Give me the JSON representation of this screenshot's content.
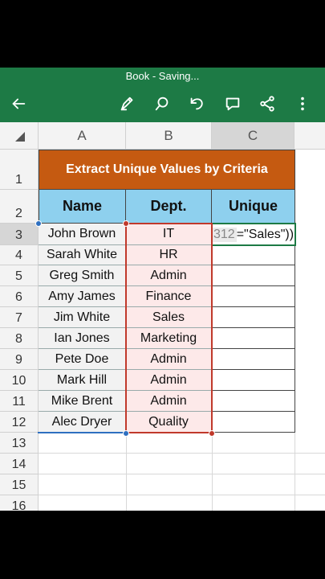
{
  "titlebar": {
    "title": "Book - Saving..."
  },
  "icons": {
    "back": "back-arrow-icon",
    "draw": "pen-icon",
    "search": "search-icon",
    "undo": "undo-icon",
    "comment": "comment-icon",
    "share": "share-icon",
    "more": "more-vertical-icon"
  },
  "columns": [
    "A",
    "B",
    "C"
  ],
  "rows": [
    "1",
    "2",
    "3",
    "4",
    "5",
    "6",
    "7",
    "8",
    "9",
    "10",
    "11",
    "12",
    "13",
    "14",
    "15",
    "16"
  ],
  "sheet": {
    "banner": "Extract Unique Values by Criteria",
    "headers": {
      "name": "Name",
      "dept": "Dept.",
      "unique": "Unique"
    },
    "data": [
      {
        "name": "John Brown",
        "dept": "IT"
      },
      {
        "name": "Sarah White",
        "dept": "HR"
      },
      {
        "name": "Greg Smith",
        "dept": "Admin"
      },
      {
        "name": "Amy James",
        "dept": "Finance"
      },
      {
        "name": "Jim White",
        "dept": "Sales"
      },
      {
        "name": "Ian Jones",
        "dept": "Marketing"
      },
      {
        "name": "Pete Doe",
        "dept": "Admin"
      },
      {
        "name": "Mark Hill",
        "dept": "Admin"
      },
      {
        "name": "Mike Brent",
        "dept": "Admin"
      },
      {
        "name": "Alec Dryer",
        "dept": "Quality"
      }
    ],
    "formula": {
      "ref": "312",
      "rest": " =\"Sales\"))"
    }
  },
  "colors": {
    "accent": "#1d7a45",
    "banner": "#c55a11",
    "header": "#8ed0ee",
    "refA": "#2e6fc0",
    "refB": "#c0392b"
  }
}
